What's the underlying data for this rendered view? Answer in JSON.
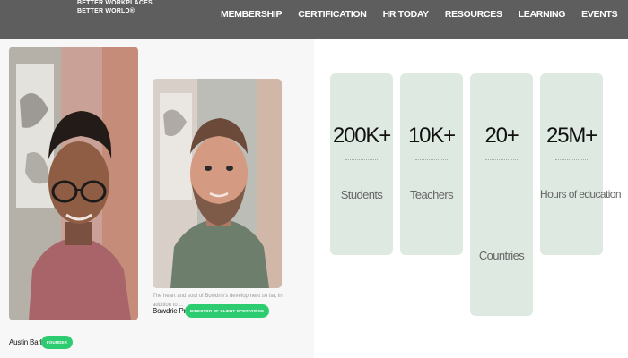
{
  "header": {
    "logo_lines": [
      "BETTER WORKPLACES",
      "BETTER WORLD®"
    ],
    "nav": [
      {
        "label": "MEMBERSHIP"
      },
      {
        "label": "CERTIFICATION"
      },
      {
        "label": "HR TODAY"
      },
      {
        "label": "RESOURCES"
      },
      {
        "label": "LEARNING"
      },
      {
        "label": "EVENTS"
      }
    ],
    "search_icon": "search-icon"
  },
  "team": {
    "members": [
      {
        "name": "Austin Barber",
        "role": "FOUNDER",
        "photo": "portrait-photo"
      },
      {
        "name": "Bowdrie Price",
        "role": "DIRECTOR OF CLIENT OPERATIONS",
        "bio": "The heart and soul of Bowdrie's development so far, in addition to ...",
        "photo": "portrait-photo"
      }
    ]
  },
  "stats": [
    {
      "value": "200K+",
      "label": "Students"
    },
    {
      "value": "10K+",
      "label": "Teachers"
    },
    {
      "value": "20+",
      "label": "Countries"
    },
    {
      "value": "25M+",
      "label": "Hours of education"
    }
  ],
  "colors": {
    "header_bg": "#5e5e5e",
    "badge_green": "#2ecc71",
    "stat_card_bg": "#dde9e1"
  }
}
